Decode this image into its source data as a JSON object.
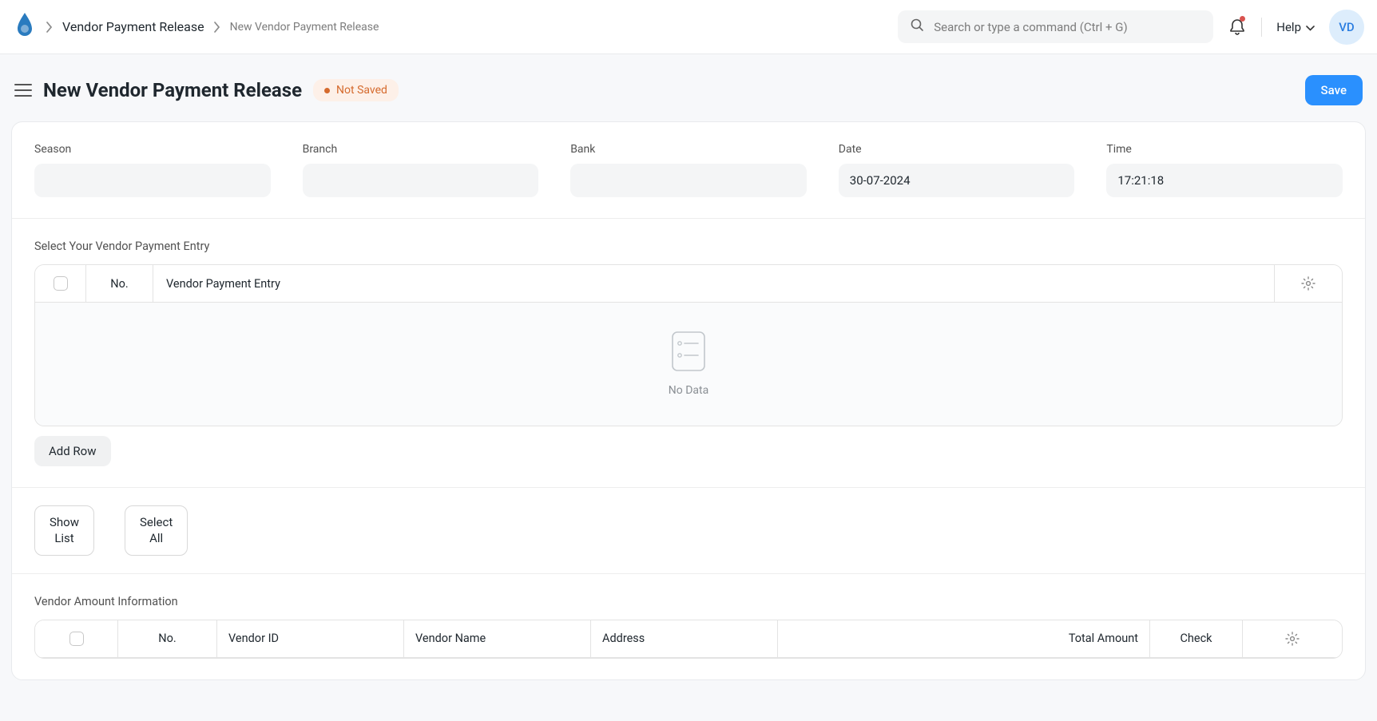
{
  "nav": {
    "breadcrumb": {
      "item1": "Vendor Payment Release",
      "item2": "New Vendor Payment Release"
    },
    "search_placeholder": "Search or type a command (Ctrl + G)",
    "help_label": "Help",
    "avatar_initials": "VD"
  },
  "header": {
    "title": "New Vendor Payment Release",
    "status_label": "Not Saved",
    "save_label": "Save"
  },
  "form": {
    "season": {
      "label": "Season",
      "value": ""
    },
    "branch": {
      "label": "Branch",
      "value": ""
    },
    "bank": {
      "label": "Bank",
      "value": ""
    },
    "date": {
      "label": "Date",
      "value": "30-07-2024"
    },
    "time": {
      "label": "Time",
      "value": "17:21:18"
    }
  },
  "entry_section": {
    "title": "Select Your Vendor Payment Entry",
    "col_no": "No.",
    "col_entry": "Vendor Payment Entry",
    "empty_text": "No Data",
    "add_row_label": "Add Row"
  },
  "actions": {
    "show_list": "Show\nList",
    "select_all": "Select\nAll"
  },
  "amount_section": {
    "title": "Vendor Amount Information",
    "col_no": "No.",
    "col_vid": "Vendor ID",
    "col_vname": "Vendor Name",
    "col_addr": "Address",
    "col_total": "Total Amount",
    "col_check": "Check"
  }
}
